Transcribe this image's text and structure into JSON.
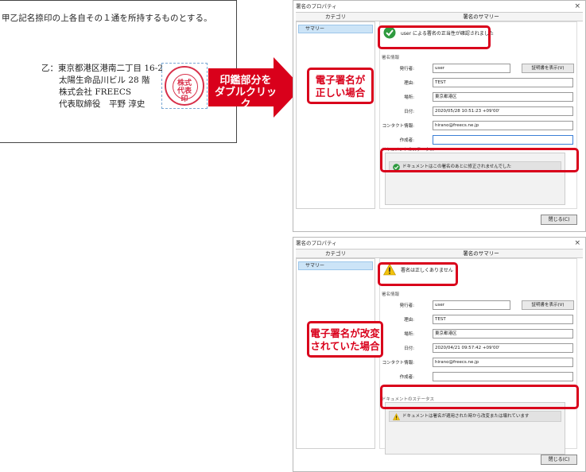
{
  "document": {
    "clause": "甲乙記名捺印の上各自その１通を所持するものとする。",
    "party_prefix": "乙：",
    "address": "東京都港区港南二丁目 16-2",
    "building": "太陽生命品川ビル 28 階",
    "company": "株式会社 FREECS",
    "representative": "代表取締役　平野 淳史"
  },
  "arrow": {
    "label": "印鑑部分を\nダブルクリック",
    "color": "#d9001b"
  },
  "dialog_common": {
    "title": "署名のプロパティ",
    "close_x": "×",
    "col_category": "カテゴリ",
    "col_summary": "署名のサマリー",
    "sidebar_item": "サマリー",
    "section_sign_info": "署名情報",
    "section_doc_status": "ドキュメントのステータス",
    "label_signer": "発行者:",
    "label_reason": "理由:",
    "label_location": "場所:",
    "label_date": "日付:",
    "label_contact": "コンタクト情報:",
    "label_author": "作成者:",
    "view_cert_button": "証明書を表示(V)",
    "close_button": "閉じる(C)"
  },
  "dialog_valid": {
    "status": "user による署名の正当性が確認されました",
    "signer": "user",
    "reason": "TEST",
    "location": "東京都港区",
    "date": "2020/05/28 10:51:23 +09'00'",
    "contact": "hirano@freecs.ne.jp",
    "author": "",
    "doc_status": "ドキュメントはこの署名のあとに修正されませんでした",
    "callout": "電子署名が\n正しい場合"
  },
  "dialog_invalid": {
    "status": "署名は正しくありません",
    "signer": "user",
    "reason": "TEST",
    "location": "東京都港区",
    "date": "2020/04/21 09:57:42 +09'00'",
    "contact": "hirano@freecs.ne.jp",
    "author": "",
    "doc_status": "ドキュメントは署名が適用された時から改変または壊れています",
    "callout": "電子署名が改変\nされていた場合"
  },
  "colors": {
    "highlight": "#d9001b",
    "valid_icon": "#2e9a3e",
    "warning_icon": "#f2c20b",
    "seal": "#d8304a"
  }
}
